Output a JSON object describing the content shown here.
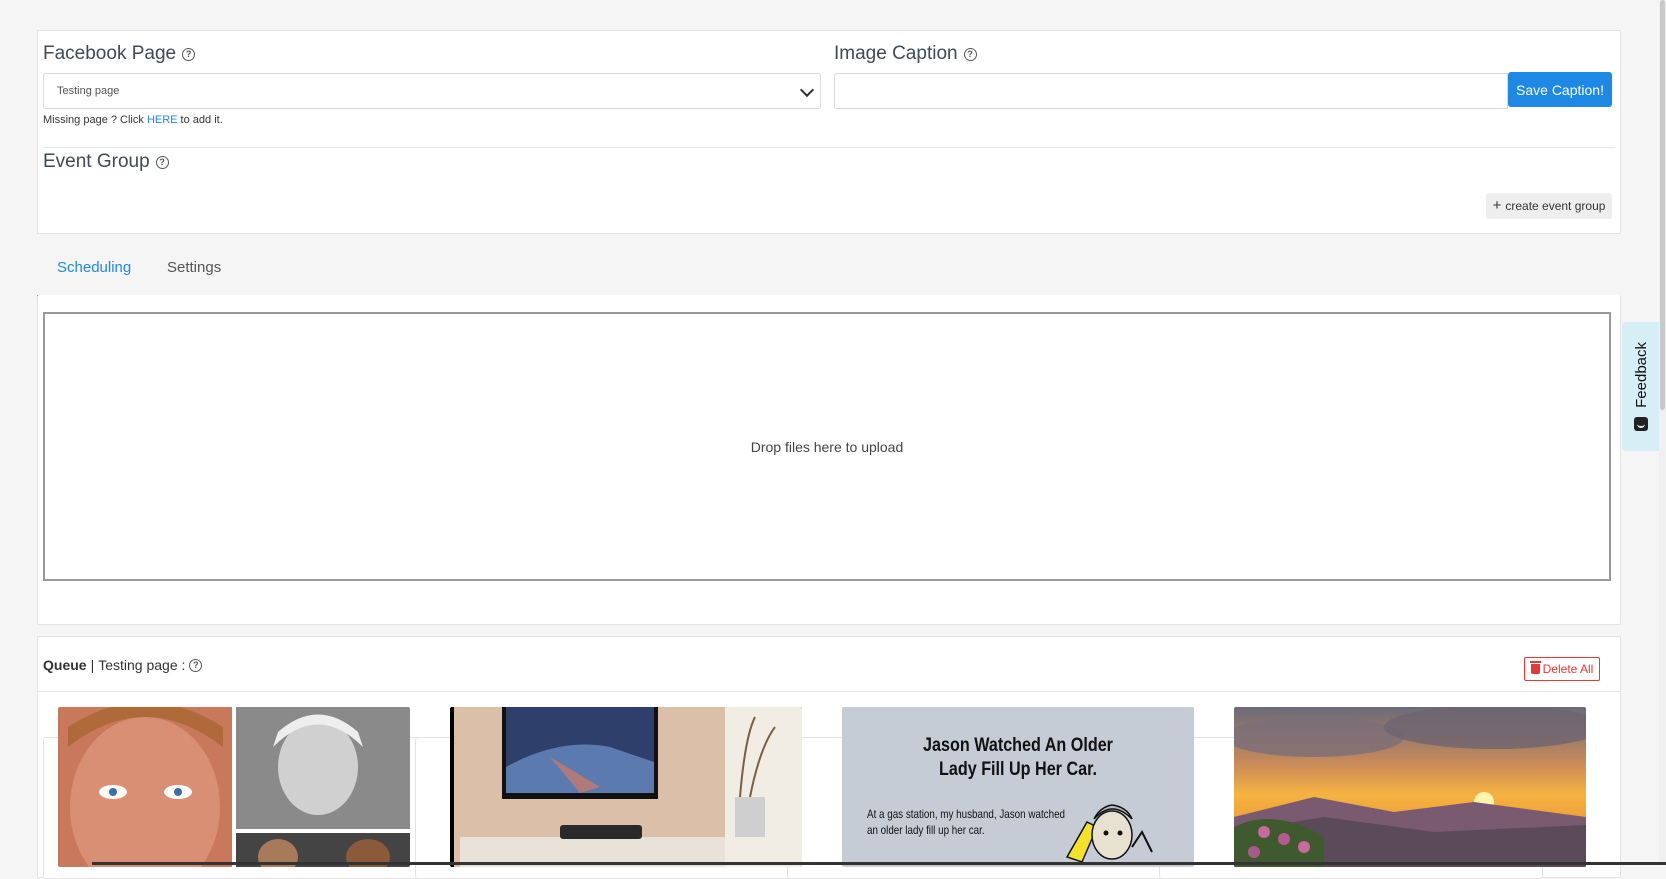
{
  "facebook_page": {
    "label": "Facebook Page",
    "selected": "Testing page",
    "missing_prefix": "Missing page ? Click ",
    "missing_link": "HERE",
    "missing_suffix": " to add it."
  },
  "image_caption": {
    "label": "Image Caption",
    "value": "",
    "save_label": "Save Caption!"
  },
  "event_group": {
    "label": "Event Group",
    "create_label": "create event group"
  },
  "tabs": [
    {
      "label": "Scheduling",
      "active": true
    },
    {
      "label": "Settings",
      "active": false
    }
  ],
  "dropzone": {
    "text": "Drop files here to upload"
  },
  "queue": {
    "title": "Queue",
    "separator": "|",
    "page": "Testing page :",
    "delete_all": "Delete All",
    "items": [
      {
        "kind": "photo-collage"
      },
      {
        "kind": "photo-living-room"
      },
      {
        "kind": "comic",
        "headline_1": "Jason Watched An Older",
        "headline_2": "Lady Fill Up Her Car.",
        "body_1": "At a gas station, my husband, Jason watched",
        "body_2": "an older lady fill up her car."
      },
      {
        "kind": "photo-sunset"
      }
    ]
  },
  "feedback": {
    "label": "Feedback"
  },
  "colors": {
    "accent": "#1e88e5",
    "danger": "#e53935",
    "feedback_bg": "#d6eef5"
  }
}
